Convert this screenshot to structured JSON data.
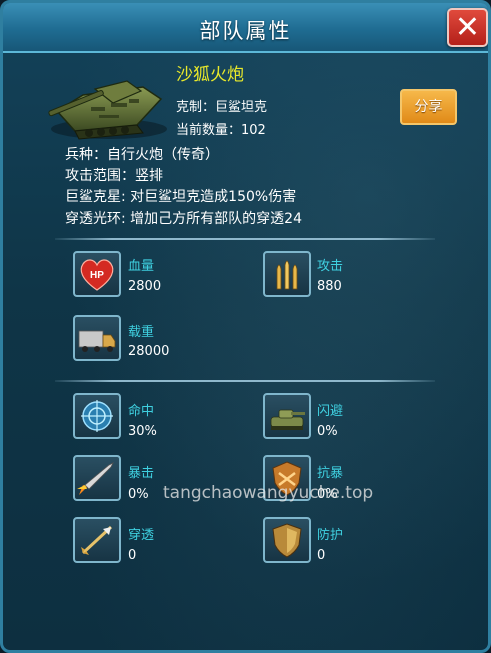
{
  "window": {
    "title": "部队属性",
    "close_symbol": "✕"
  },
  "unit": {
    "name": "沙狐火炮",
    "counter": "克制：巨鲨坦克",
    "count": "当前数量：102",
    "image": "tank-icon"
  },
  "actions": {
    "share_label": "分享"
  },
  "description": [
    "兵种：自行火炮（传奇）",
    "攻击范围：竖排",
    "巨鲨克星: 对巨鲨坦克造成150%伤害",
    "穿透光环: 增加己方所有部队的穿透24"
  ],
  "stats_primary": [
    {
      "label": "血量",
      "value": "2800",
      "icon": "hp-heart-icon"
    },
    {
      "label": "攻击",
      "value": "880",
      "icon": "bullets-icon"
    },
    {
      "label": "载重",
      "value": "28000",
      "icon": "truck-icon"
    }
  ],
  "stats_secondary": [
    {
      "label": "命中",
      "value": "30%",
      "icon": "crosshair-icon"
    },
    {
      "label": "闪避",
      "value": "0%",
      "icon": "tank-dodge-icon"
    },
    {
      "label": "暴击",
      "value": "0%",
      "icon": "missile-crit-icon"
    },
    {
      "label": "抗暴",
      "value": "0%",
      "icon": "shield-crit-resist-icon"
    },
    {
      "label": "穿透",
      "value": "0",
      "icon": "arrow-pierce-icon"
    },
    {
      "label": "防护",
      "value": "0",
      "icon": "armor-shield-icon"
    }
  ],
  "watermark": "tangchaowangyuche.top",
  "colors": {
    "title_bar": "#1f6c92",
    "unit_name": "#e9e92a",
    "stat_label": "#3fd0e0",
    "share_button": "#e08a18",
    "close_button": "#b4201a"
  }
}
